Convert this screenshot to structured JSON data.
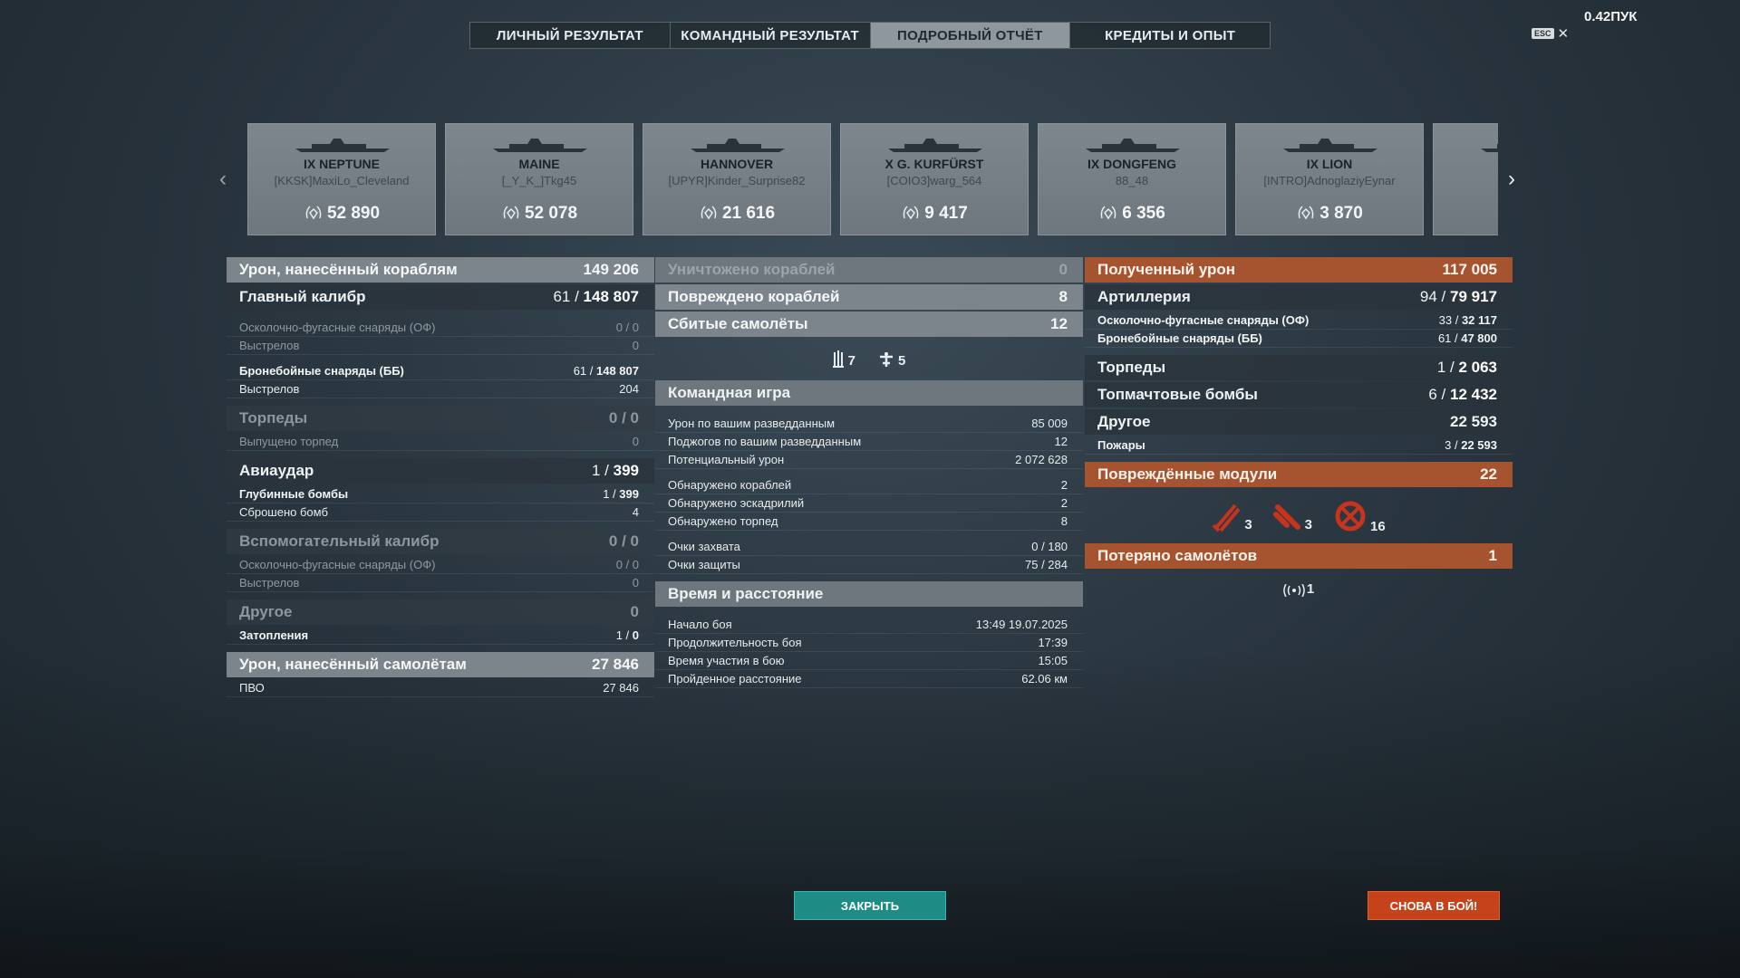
{
  "tabs": [
    {
      "label": "ЛИЧНЫЙ РЕЗУЛЬТАТ",
      "active": false
    },
    {
      "label": "КОМАНДНЫЙ РЕЗУЛЬТАТ",
      "active": false
    },
    {
      "label": "ПОДРОБНЫЙ ОТЧЁТ",
      "active": true
    },
    {
      "label": "КРЕДИТЫ И ОПЫТ",
      "active": false
    }
  ],
  "top_right": {
    "points": "0.42ПУК",
    "esc_label": "ESC",
    "close_glyph": "✕"
  },
  "ships": [
    {
      "name": "IX NEPTUNE",
      "player": "[KKSK]MaxiLo_Cleveland",
      "damage": "52 890"
    },
    {
      "name": "MAINE",
      "player": "[_Y_K_]Tkg45",
      "damage": "52 078"
    },
    {
      "name": "HANNOVER",
      "player": "[UPYR]Kinder_Surprise82",
      "damage": "21 616"
    },
    {
      "name": "X G. KURFÜRST",
      "player": "[COIO3]warg_564",
      "damage": "9 417"
    },
    {
      "name": "IX DONGFENG",
      "player": "88_48",
      "damage": "6 356"
    },
    {
      "name": "IX LION",
      "player": "[INTRO]AdnoglaziyEynar",
      "damage": "3 870"
    }
  ],
  "left": {
    "ship_damage": {
      "label": "Урон, нанесённый кораблям",
      "value": "149 206"
    },
    "main_caliber": {
      "label": "Главный калибр",
      "hits": "61 / ",
      "value": "148 807"
    },
    "he_shells": {
      "label": "Осколочно-фугасные снаряды (ОФ)",
      "value": "0 / 0"
    },
    "he_shots": {
      "label": "Выстрелов",
      "value": "0"
    },
    "ap_shells": {
      "label": "Бронебойные снаряды (ББ)",
      "hits": "61 / ",
      "value": "148 807"
    },
    "ap_shots": {
      "label": "Выстрелов",
      "value": "204"
    },
    "torpedoes": {
      "label": "Торпеды",
      "value": "0 / 0"
    },
    "torps_launched": {
      "label": "Выпущено торпед",
      "value": "0"
    },
    "airstrike": {
      "label": "Авиаудар",
      "hits": "1 / ",
      "value": "399"
    },
    "depth_charges": {
      "label": "Глубинные бомбы",
      "hits": "1 / ",
      "value": "399"
    },
    "bombs_dropped": {
      "label": "Сброшено бомб",
      "value": "4"
    },
    "secondary": {
      "label": "Вспомогательный калибр",
      "value": "0 / 0"
    },
    "sec_he": {
      "label": "Осколочно-фугасные снаряды (ОФ)",
      "value": "0 / 0"
    },
    "sec_shots": {
      "label": "Выстрелов",
      "value": "0"
    },
    "other": {
      "label": "Другое",
      "value": "0"
    },
    "flooding": {
      "label": "Затопления",
      "hits": "1 / ",
      "value": "0"
    },
    "plane_damage": {
      "label": "Урон, нанесённый самолётам",
      "value": "27 846"
    },
    "aa": {
      "label": "ПВО",
      "value": "27 846"
    }
  },
  "middle": {
    "destroyed": {
      "label": "Уничтожено кораблей",
      "value": "0"
    },
    "damaged": {
      "label": "Повреждено кораблей",
      "value": "8"
    },
    "planes_shot": {
      "label": "Сбитые самолёты",
      "value": "12"
    },
    "plane_types": [
      {
        "icon": "fighter-plane-icon",
        "count": "7"
      },
      {
        "icon": "bomber-plane-icon",
        "count": "5"
      }
    ],
    "teamplay": {
      "label": "Командная игра"
    },
    "team_rows": [
      {
        "label": "Урон по вашим разведданным",
        "value": "85 009"
      },
      {
        "label": "Поджогов по вашим разведданным",
        "value": "12"
      },
      {
        "label": "Потенциальный урон",
        "value": "2 072 628"
      }
    ],
    "spot_rows": [
      {
        "label": "Обнаружено кораблей",
        "value": "2"
      },
      {
        "label": "Обнаружено эскадрилий",
        "value": "2"
      },
      {
        "label": "Обнаружено торпед",
        "value": "8"
      }
    ],
    "cap_rows": [
      {
        "label": "Очки захвата",
        "value": "0 / 180"
      },
      {
        "label": "Очки защиты",
        "value": "75 / 284"
      }
    ],
    "time": {
      "label": "Время и расстояние"
    },
    "time_rows": [
      {
        "label": "Начало боя",
        "value": "13:49  19.07.2025"
      },
      {
        "label": "Продолжительность боя",
        "value": "17:39"
      },
      {
        "label": "Время участия в бою",
        "value": "15:05"
      },
      {
        "label": "Пройденное расстояние",
        "value": "62.06 км"
      }
    ]
  },
  "right": {
    "received": {
      "label": "Полученный урон",
      "value": "117 005"
    },
    "artillery": {
      "label": "Артиллерия",
      "hits": "94 / ",
      "value": "79 917"
    },
    "he": {
      "label": "Осколочно-фугасные снаряды (ОФ)",
      "hits": "33 / ",
      "value": "32 117"
    },
    "ap": {
      "label": "Бронебойные снаряды (ББ)",
      "hits": "61 / ",
      "value": "47 800"
    },
    "torpedoes": {
      "label": "Торпеды",
      "hits": "1 / ",
      "value": "2 063"
    },
    "skip_bombs": {
      "label": "Топмачтовые бомбы",
      "hits": "6 / ",
      "value": "12 432"
    },
    "other": {
      "label": "Другое",
      "value": "22 593"
    },
    "fires": {
      "label": "Пожары",
      "hits": "3 / ",
      "value": "22 593"
    },
    "modules": {
      "label": "Повреждённые модули",
      "value": "22"
    },
    "module_icons": [
      {
        "icon": "gun-module-icon",
        "count": "3"
      },
      {
        "icon": "torpedo-module-icon",
        "count": "3"
      },
      {
        "icon": "engine-module-icon",
        "count": "16"
      }
    ],
    "planes_lost": {
      "label": "Потеряно самолётов",
      "value": "1"
    },
    "spotter": {
      "icon": "spotter-icon",
      "count": "1"
    }
  },
  "buttons": {
    "close": "ЗАКРЫТЬ",
    "battle": "СНОВА В БОЙ!"
  },
  "colors": {
    "accent_orange": "#a65430",
    "close_teal": "#1f8b85",
    "battle_red": "#c6421a",
    "module_red": "#c6341e"
  }
}
